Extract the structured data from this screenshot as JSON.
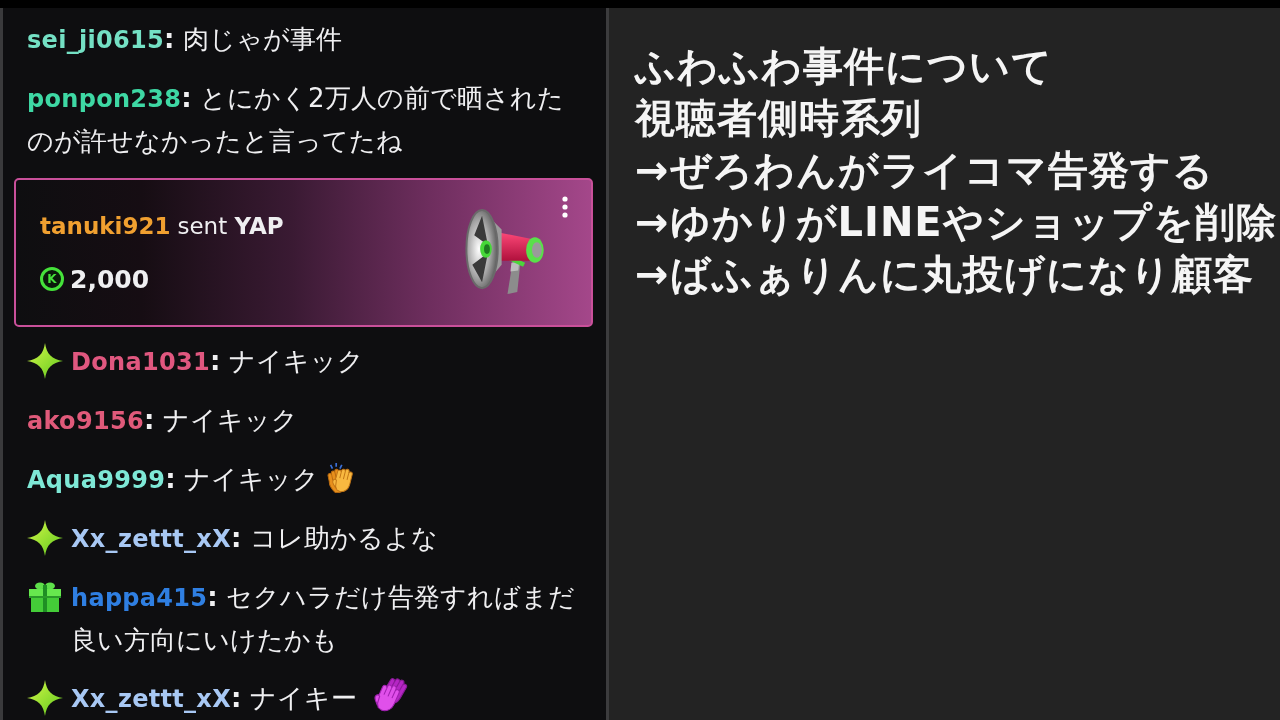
{
  "chat": {
    "messages": [
      {
        "kind": "message",
        "username": "sei_ji0615",
        "color": "#74e0c4",
        "text": "**:** 肉じゃが事件"
      },
      {
        "kind": "message",
        "username": "ponpon238",
        "color": "#3ed8a4",
        "text": "**:** とにかく2万人の前で晒されたのが許せなかったと言ってたね"
      },
      {
        "kind": "gift",
        "username": "tanuki921",
        "color": "#f0a030",
        "text": "sent **YAP**",
        "currency": "K",
        "amount": "2,000"
      },
      {
        "kind": "message",
        "badge": {
          "kind": "sparkle"
        },
        "username": "Dona1031",
        "color": "#e0577f",
        "text": "**:** ナイキック"
      },
      {
        "kind": "message",
        "username": "ako9156",
        "color": "#e05a7a",
        "text": "**:** ナイキック"
      },
      {
        "kind": "message",
        "username": "Aqua9999",
        "color": "#7ee8d6",
        "text": "**:** ナイキック",
        "emote": {
          "kind": "clap"
        }
      },
      {
        "kind": "message",
        "badge": {
          "kind": "sparkle"
        },
        "username": "Xx_zettt_xX",
        "color": "#a8c8f4",
        "text": "**:** コレ助かるよな"
      },
      {
        "kind": "message",
        "badge": {
          "kind": "gift"
        },
        "username": "happa415",
        "color": "#2f7fe2",
        "text": "**:** セクハラだけ告発すればまだ良い方向にいけたかも"
      },
      {
        "kind": "message",
        "badge": {
          "kind": "sparkle"
        },
        "username": "Xx_zettt_xX",
        "color": "#a8c8f4",
        "text": "**:** ナイキー",
        "emote": {
          "kind": "hands"
        }
      }
    ]
  },
  "overlay": {
    "lines": [
      "ふわふわ事件について",
      "視聴者側時系列",
      "→ぜろわんがライコマ告発する",
      "→ゆかりがLINEやショップを削除",
      "→ばふぁりんに丸投げになり顧客"
    ]
  }
}
